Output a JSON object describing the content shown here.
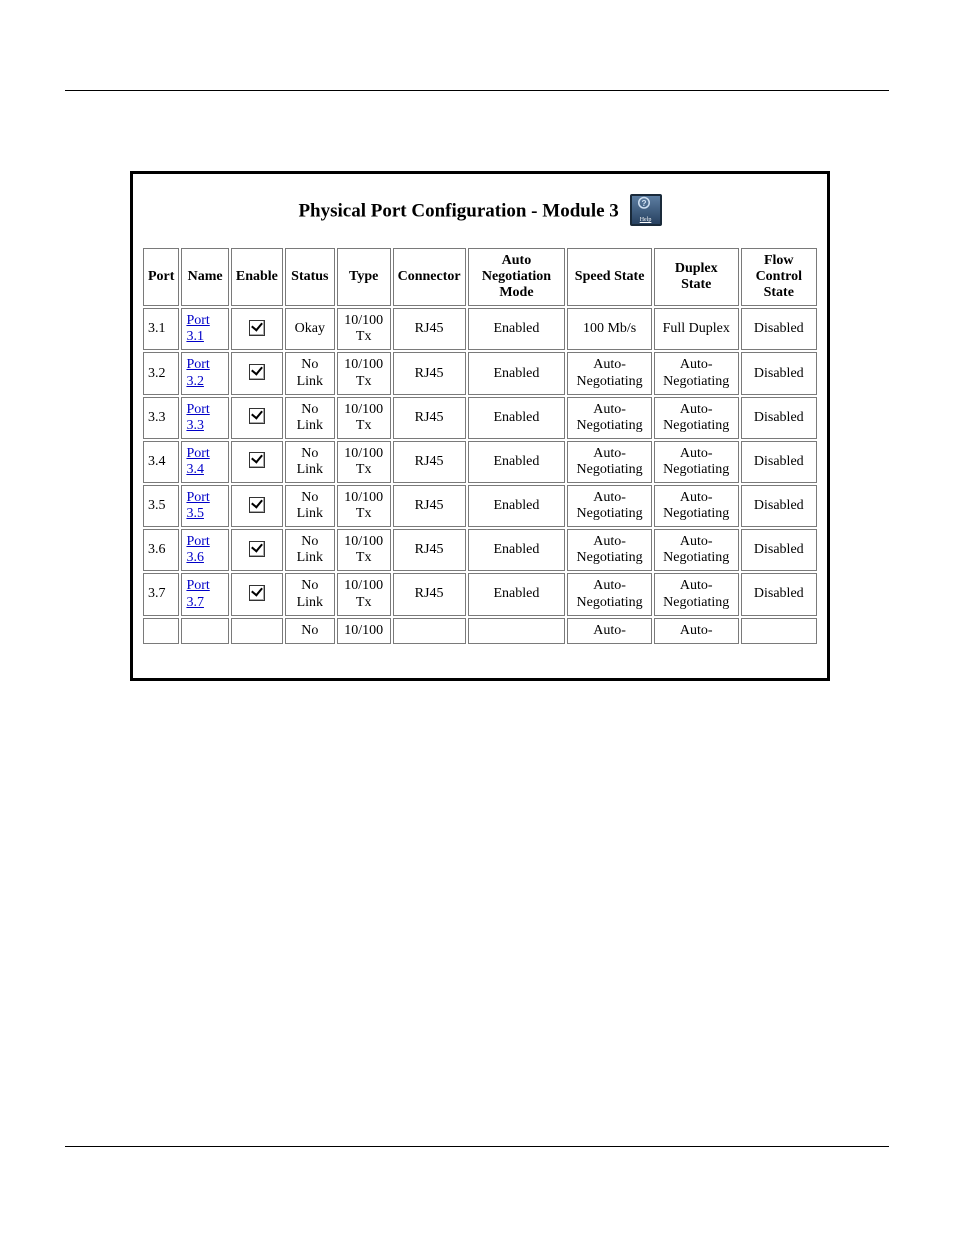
{
  "header": {
    "title": "Physical Port Configuration - Module 3",
    "help_label": "Help"
  },
  "table": {
    "columns": [
      "Port",
      "Name",
      "Enable",
      "Status",
      "Type",
      "Connector",
      "Auto Negotiation Mode",
      "Speed State",
      "Duplex State",
      "Flow Control State"
    ],
    "rows": [
      {
        "port": "3.1",
        "name": "Port 3.1",
        "enable": true,
        "status": "Okay",
        "type": "10/100 Tx",
        "connector": "RJ45",
        "auto_neg": "Enabled",
        "speed": "100 Mb/s",
        "duplex": "Full Duplex",
        "flow": "Disabled"
      },
      {
        "port": "3.2",
        "name": "Port 3.2",
        "enable": true,
        "status": "No Link",
        "type": "10/100 Tx",
        "connector": "RJ45",
        "auto_neg": "Enabled",
        "speed": "Auto-Negotiating",
        "duplex": "Auto-Negotiating",
        "flow": "Disabled"
      },
      {
        "port": "3.3",
        "name": "Port 3.3",
        "enable": true,
        "status": "No Link",
        "type": "10/100 Tx",
        "connector": "RJ45",
        "auto_neg": "Enabled",
        "speed": "Auto-Negotiating",
        "duplex": "Auto-Negotiating",
        "flow": "Disabled"
      },
      {
        "port": "3.4",
        "name": "Port 3.4",
        "enable": true,
        "status": "No Link",
        "type": "10/100 Tx",
        "connector": "RJ45",
        "auto_neg": "Enabled",
        "speed": "Auto-Negotiating",
        "duplex": "Auto-Negotiating",
        "flow": "Disabled"
      },
      {
        "port": "3.5",
        "name": "Port 3.5",
        "enable": true,
        "status": "No Link",
        "type": "10/100 Tx",
        "connector": "RJ45",
        "auto_neg": "Enabled",
        "speed": "Auto-Negotiating",
        "duplex": "Auto-Negotiating",
        "flow": "Disabled"
      },
      {
        "port": "3.6",
        "name": "Port 3.6",
        "enable": true,
        "status": "No Link",
        "type": "10/100 Tx",
        "connector": "RJ45",
        "auto_neg": "Enabled",
        "speed": "Auto-Negotiating",
        "duplex": "Auto-Negotiating",
        "flow": "Disabled"
      },
      {
        "port": "3.7",
        "name": "Port 3.7",
        "enable": true,
        "status": "No Link",
        "type": "10/100 Tx",
        "connector": "RJ45",
        "auto_neg": "Enabled",
        "speed": "Auto-Negotiating",
        "duplex": "Auto-Negotiating",
        "flow": "Disabled"
      },
      {
        "port": "",
        "name": "",
        "enable": null,
        "status": "No",
        "type": "10/100",
        "connector": "",
        "auto_neg": "",
        "speed": "Auto-",
        "duplex": "Auto-",
        "flow": ""
      }
    ]
  }
}
